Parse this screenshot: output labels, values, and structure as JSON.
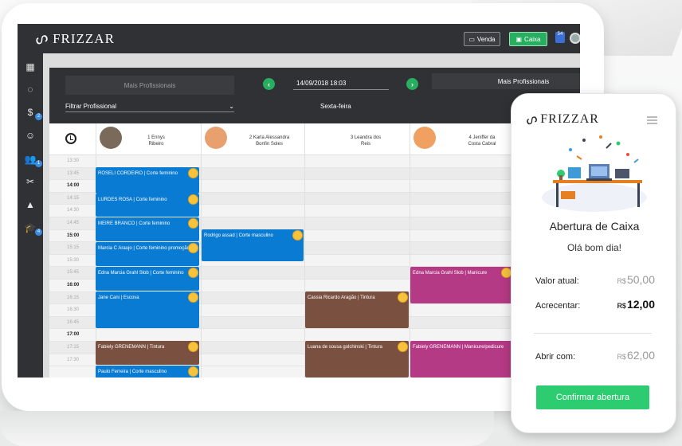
{
  "app": {
    "brand": "FRIZZAR"
  },
  "topbar": {
    "venda_label": "Venda",
    "caixa_label": "Caixa",
    "badge": "54"
  },
  "sidebar": {
    "badges": {
      "money": "2",
      "users": "1",
      "courses": "4"
    }
  },
  "calendar": {
    "mais_left": "Mais Profissionais",
    "mais_right": "Mais Profissionais",
    "filter_label": "Filtrar Profissional",
    "date": "14/09/2018 18:03",
    "weekday": "Sexta-feira",
    "professionals": [
      {
        "name1": "1 Ennys",
        "name2": "Ribeiro"
      },
      {
        "name1": "2 Karla Alessandra",
        "name2": "Bonfin Soles"
      },
      {
        "name1": "3 Leandra dos",
        "name2": "Reis"
      },
      {
        "name1": "4 Jeniffer da",
        "name2": "Costa Cabral"
      }
    ],
    "times": [
      "13:30",
      "13:45",
      "14:00",
      "14:15",
      "14:30",
      "14:45",
      "15:00",
      "15:15",
      "15:30",
      "15:45",
      "16:00",
      "16:15",
      "16:30",
      "16:45",
      "17:00",
      "17:15",
      "17:30"
    ],
    "appointments": [
      {
        "text": "ROSELI CORDEIRO  |  Corte feminino"
      },
      {
        "text": "LURDES ROSA  |  Corte feminino"
      },
      {
        "text": "MEIRE BRANCO  |  Corte feminino"
      },
      {
        "text": "Marcia C Araujo  |  Corte feminino promoção"
      },
      {
        "text": "Edna Marcia Grahl Slob  |  Corte feminino"
      },
      {
        "text": "Jane Cani  |  Escova"
      },
      {
        "text": "Fabiely GRENEMANN  |  Tintura"
      },
      {
        "text": "Paulo Ferreira  |  Corte masculino"
      },
      {
        "text": "Rodrigo assad  |  Corte masculino"
      },
      {
        "text": "Cassia Ricardo Aragão  |  Tintura"
      },
      {
        "text": "Luana de sousa golchinski  |  Tintura"
      },
      {
        "text": "Edna Marcia Grahl Slob  |  Manicure"
      },
      {
        "text": "Fabiely GRENEMANN  |  Manicure/pedicure"
      }
    ]
  },
  "phone": {
    "brand": "FRIZZAR",
    "title": "Abertura de Caixa",
    "greeting": "Olá bom dia!",
    "valor_atual_label": "Valor atual:",
    "valor_atual_cur": "R$",
    "valor_atual": "50,00",
    "acrescentar_label": "Acrecentar:",
    "acrescentar_cur": "R$",
    "acrescentar": "12,00",
    "abrir_label": "Abrir com:",
    "abrir_cur": "R$",
    "abrir": "62,00",
    "confirm_label": "Confirmar abertura"
  },
  "colors": {
    "accent": "#27ae60",
    "blue": "#0a7bd2",
    "brown": "#7a5140",
    "purple": "#b53a85",
    "dark": "#2f3134"
  }
}
